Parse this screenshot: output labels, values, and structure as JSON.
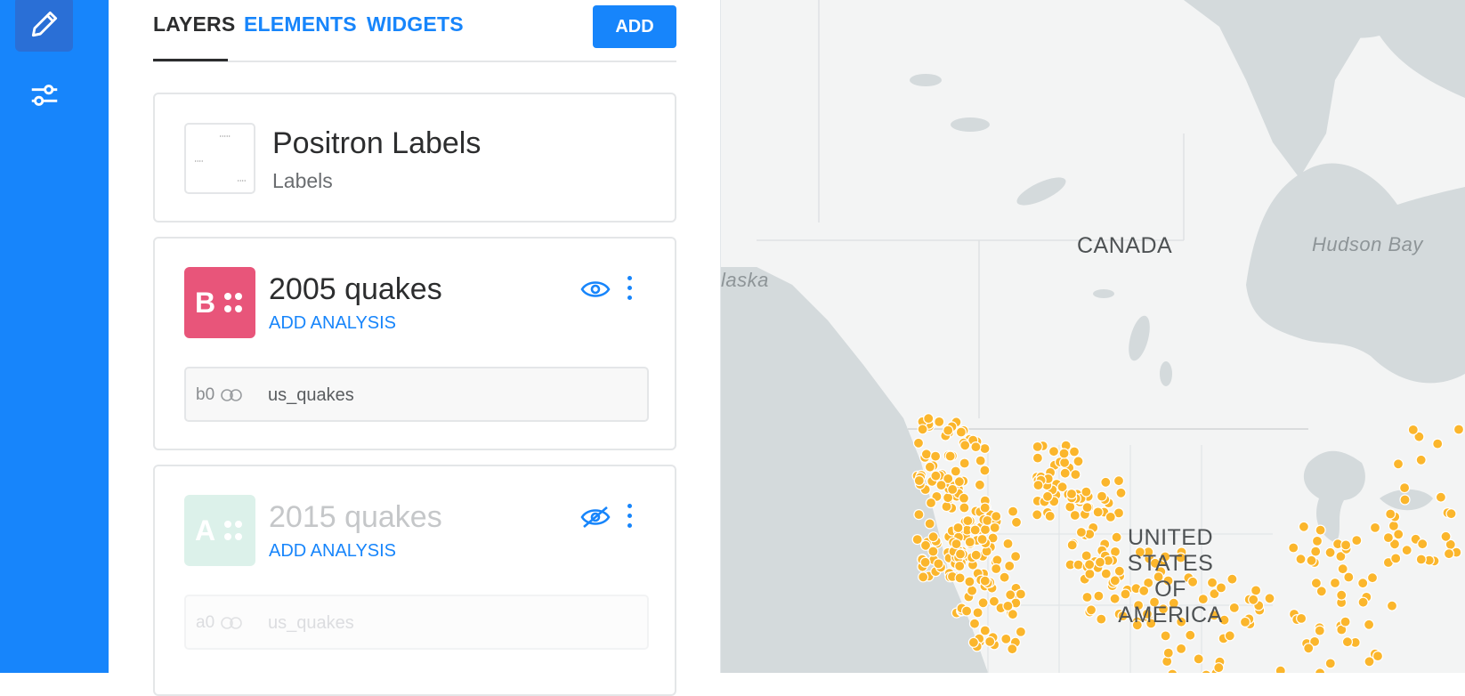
{
  "rail": {
    "items": [
      {
        "name": "edit",
        "icon": "pencil-icon",
        "active": true
      },
      {
        "name": "settings",
        "icon": "sliders-icon",
        "active": false
      }
    ]
  },
  "tabs": {
    "items": [
      {
        "label": "LAYERS",
        "active": true
      },
      {
        "label": "ELEMENTS",
        "active": false
      },
      {
        "label": "WIDGETS",
        "active": false
      }
    ],
    "add_label": "ADD"
  },
  "basemap": {
    "title": "Positron Labels",
    "subtitle": "Labels"
  },
  "layers": [
    {
      "letter": "B",
      "title": "2005 quakes",
      "action": "ADD ANALYSIS",
      "color": "#E8557A",
      "visible": true,
      "source_id": "b0",
      "source_name": "us_quakes"
    },
    {
      "letter": "A",
      "title": "2015 quakes",
      "action": "ADD ANALYSIS",
      "color": "#DCF1EA",
      "visible": false,
      "source_id": "a0",
      "source_name": "us_quakes"
    }
  ],
  "map": {
    "labels": {
      "canada": "CANADA",
      "hudson_bay": "Hudson Bay",
      "alaska": "laska",
      "usa_line1": "UNITED",
      "usa_line2": "STATES OF",
      "usa_line3": "AMERICA"
    },
    "point_color": "#FBB62C"
  },
  "colors": {
    "accent": "#1785FB",
    "ocean": "#D4DADC",
    "land": "#F3F4F4"
  }
}
